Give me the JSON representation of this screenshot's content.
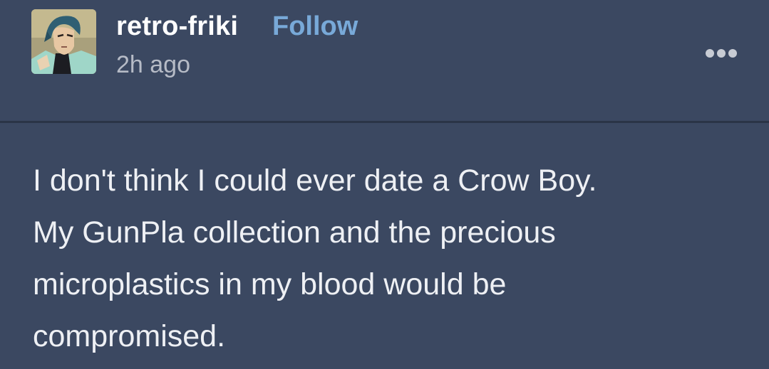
{
  "post": {
    "author": {
      "username": "retro-friki",
      "avatar_icon": "anime-character-avatar"
    },
    "follow_label": "Follow",
    "timestamp": "2h ago",
    "more_icon": "ellipsis-icon",
    "body_lines": [
      "I don't think I could ever date a Crow Boy.",
      "My GunPla collection and the precious",
      "microplastics in my blood would be",
      "compromised."
    ]
  },
  "colors": {
    "background": "#3b4861",
    "follow_link": "#78a9d8",
    "divider": "#2a3447"
  }
}
